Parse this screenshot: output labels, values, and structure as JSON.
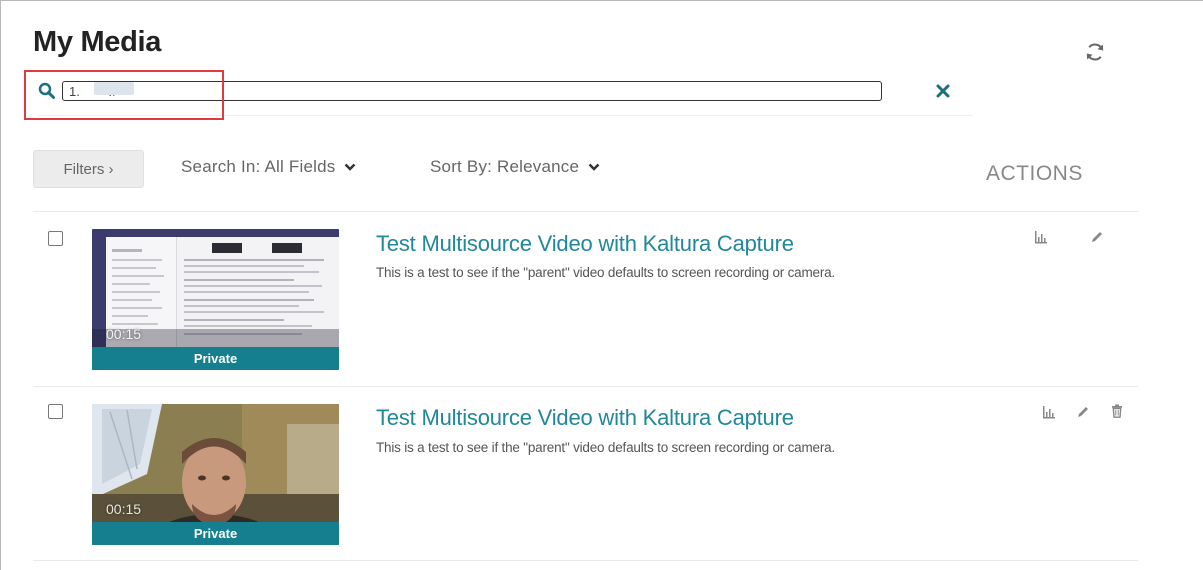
{
  "page": {
    "title": "My Media",
    "refresh_icon": "refresh-icon"
  },
  "search": {
    "value": "1.        r/",
    "icon": "search-icon",
    "clear_icon": "close-icon"
  },
  "toolbar": {
    "filters_label": "Filters  ›",
    "search_in_label": "Search In: All Fields",
    "sort_by_label": "Sort By: Relevance",
    "actions_label": "ACTIONS"
  },
  "entries": [
    {
      "title": "Test Multisource Video with Kaltura Capture",
      "description": "This is a test to see if the \"parent\" video defaults to screen recording or camera.",
      "duration": "00:15",
      "status": "Private",
      "actions": [
        "stats-icon",
        "edit-icon"
      ]
    },
    {
      "title": "Test Multisource Video with Kaltura Capture",
      "description": "This is a test to see if the \"parent\" video defaults to screen recording or camera.",
      "duration": "00:15",
      "status": "Private",
      "actions": [
        "stats-icon",
        "edit-icon",
        "delete-icon"
      ]
    }
  ],
  "colors": {
    "accent": "#21879a",
    "status_bar": "#157f8f",
    "highlight": "#e0393e",
    "search_icon": "#1a6f80"
  }
}
